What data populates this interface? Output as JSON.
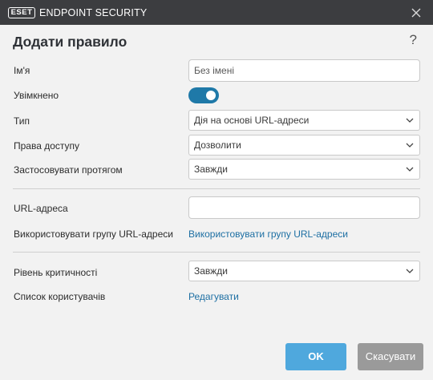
{
  "window": {
    "logo_text": "ESET",
    "product_name": "ENDPOINT SECURITY"
  },
  "dialog": {
    "title": "Додати правило",
    "help": "?"
  },
  "form": {
    "name": {
      "label": "Ім'я",
      "placeholder": "Без імені",
      "value": ""
    },
    "enabled": {
      "label": "Увімкнено",
      "value": true
    },
    "type": {
      "label": "Тип",
      "value": "Дія на основі URL-адреси"
    },
    "access": {
      "label": "Права доступу",
      "value": "Дозволити"
    },
    "apply_during": {
      "label": "Застосовувати протягом",
      "value": "Завжди"
    },
    "url": {
      "label": "URL-адреса",
      "value": ""
    },
    "url_group": {
      "label": "Використовувати групу URL-адреси",
      "link": "Використовувати групу URL-адреси"
    },
    "severity": {
      "label": "Рівень критичності",
      "value": "Завжди"
    },
    "users": {
      "label": "Список користувачів",
      "link": "Редагувати"
    }
  },
  "buttons": {
    "ok": "OK",
    "cancel": "Скасувати"
  },
  "colors": {
    "titlebar": "#3c3d40",
    "accent": "#1f79a8",
    "link": "#1d6fa3",
    "ok_button": "#4fa8dd",
    "cancel_button": "#9a9a9a"
  }
}
